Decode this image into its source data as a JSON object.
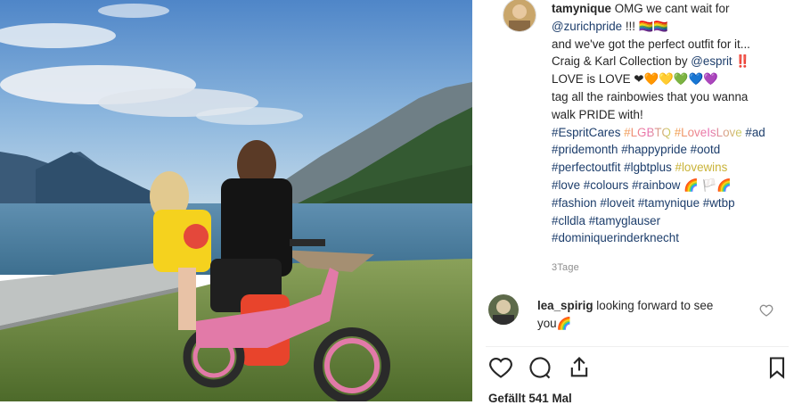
{
  "post": {
    "username": "tamynique",
    "caption_line1": "OMG we cant wait for",
    "caption_line2_mention": "@zurichpride",
    "caption_line2_rest": " !!! 🏳️‍🌈🏳️‍🌈",
    "caption_line3": "and we've got the perfect outfit for it...",
    "caption_line4_a": "Craig & Karl Collection by ",
    "caption_line4_mention": "@esprit",
    "caption_line4_b": " ‼️",
    "caption_line5": "LOVE is LOVE ❤🧡💛💚💙💜",
    "caption_line6": "tag all the rainbowies that you wanna",
    "caption_line7": "walk PRIDE with!",
    "hashtags": {
      "espritcares": "#EspritCares",
      "lgbtq": "#LGBTQ",
      "loveislove": "#LoveIsLove",
      "ad": "#ad",
      "pridemonth": "#pridemonth",
      "happypride": "#happypride",
      "ootd": "#ootd",
      "perfectoutfit": "#perfectoutfit",
      "lgbtplus": "#lgbtplus",
      "lovewins": "#lovewins",
      "love": "#love",
      "colours": "#colours",
      "rainbow": "#rainbow",
      "rainbow_emoji": "🌈",
      "flags_emoji": "🏳️🌈",
      "fashion": "#fashion",
      "loveit": "#loveit",
      "tamynique": "#tamynique",
      "wtbp": "#wtbp",
      "clldla": "#clldla",
      "tamyglauser": "#tamyglauser",
      "dominiquerinderknecht": "#dominiquerinderknecht"
    },
    "time": "3Tage"
  },
  "comment": {
    "username": "lea_spirig",
    "text_line1": "looking forward to see",
    "text_line2": "you🌈"
  },
  "likes": "Gefällt 541 Mal",
  "icons": {
    "like": "heart-icon",
    "comment": "comment-icon",
    "share": "share-icon",
    "save": "bookmark-icon",
    "comment_like": "small-heart-icon"
  },
  "colors": {
    "text": "#262626",
    "hashtag": "#1c3d6b",
    "secondary": "#8e8e8e"
  }
}
